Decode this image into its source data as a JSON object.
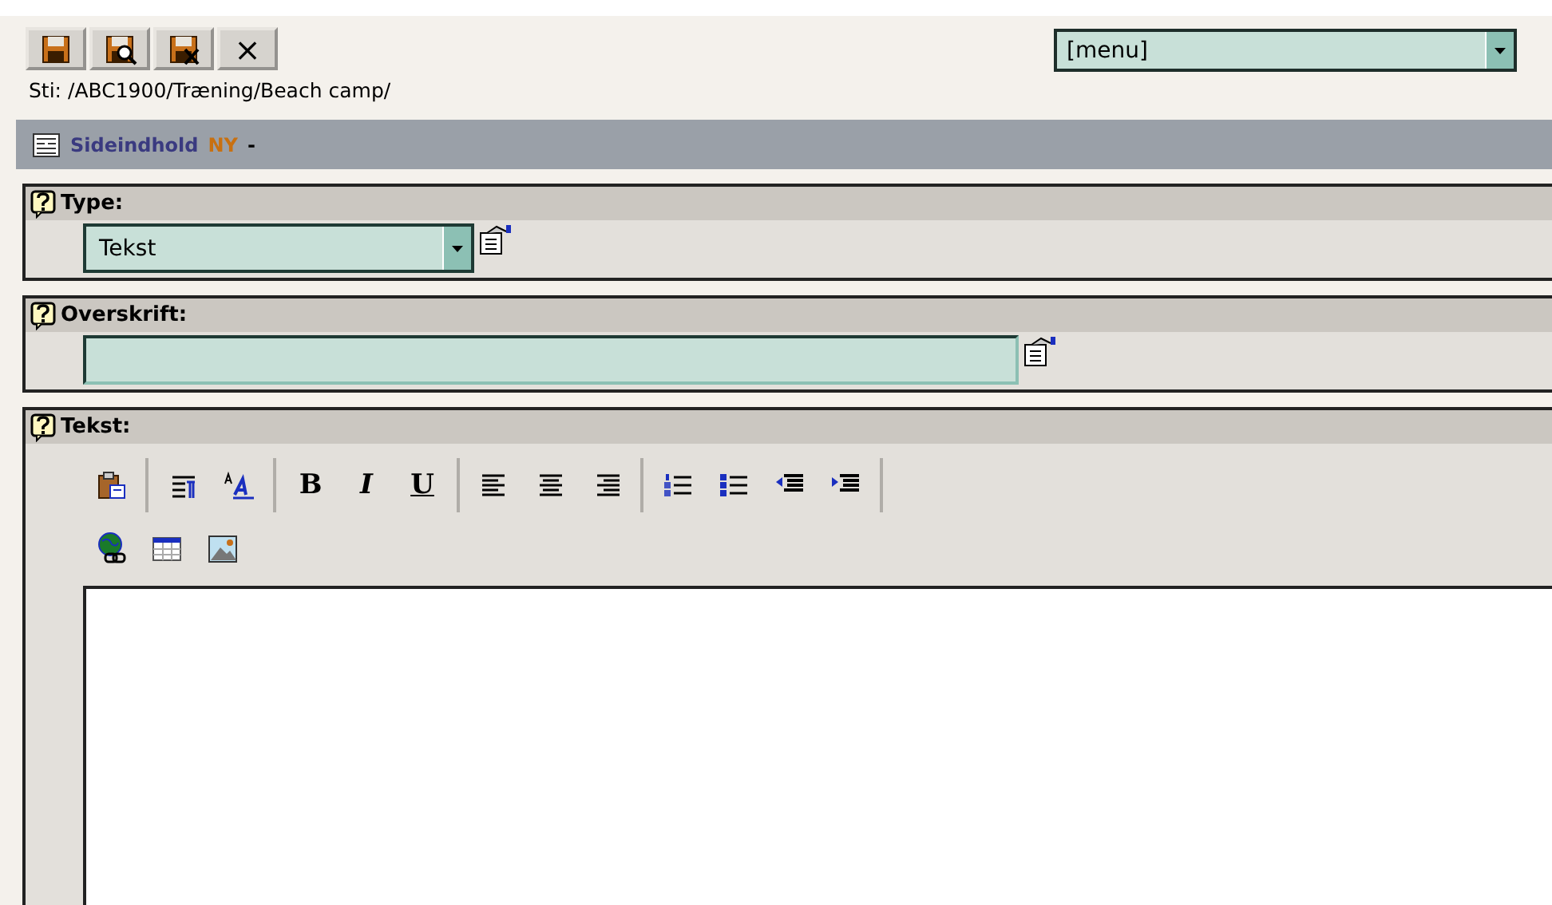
{
  "toolbar": {
    "buttons": [
      {
        "kind": "save"
      },
      {
        "kind": "preview"
      },
      {
        "kind": "save-close"
      },
      {
        "kind": "close",
        "label": "×"
      }
    ]
  },
  "menu_select": {
    "value": "[menu]"
  },
  "path": "Sti: /ABC1900/Træning/Beach camp/",
  "header": {
    "title": "Sideindhold",
    "status": "NY",
    "suffix": "-"
  },
  "fields": [
    {
      "kind": "select",
      "label": "Type:",
      "value": "Tekst"
    },
    {
      "kind": "text",
      "label": "Overskrift:"
    },
    {
      "kind": "editor",
      "label": "Tekst:",
      "toolbar_rows": [
        {
          "groups": [
            [
              {
                "kind": "paste"
              }
            ],
            [
              {
                "kind": "paragraph"
              },
              {
                "kind": "font-style"
              }
            ],
            [
              {
                "kind": "bold",
                "label": "B"
              },
              {
                "kind": "italic",
                "label": "I"
              },
              {
                "kind": "underline",
                "label": "U"
              }
            ],
            [
              {
                "kind": "align-left"
              },
              {
                "kind": "align-center"
              },
              {
                "kind": "align-right"
              }
            ],
            [
              {
                "kind": "ordered-list"
              },
              {
                "kind": "bullet-list"
              },
              {
                "kind": "outdent"
              },
              {
                "kind": "indent"
              }
            ]
          ]
        },
        {
          "groups": [
            [
              {
                "kind": "link"
              },
              {
                "kind": "table"
              },
              {
                "kind": "image"
              }
            ]
          ]
        }
      ]
    }
  ]
}
